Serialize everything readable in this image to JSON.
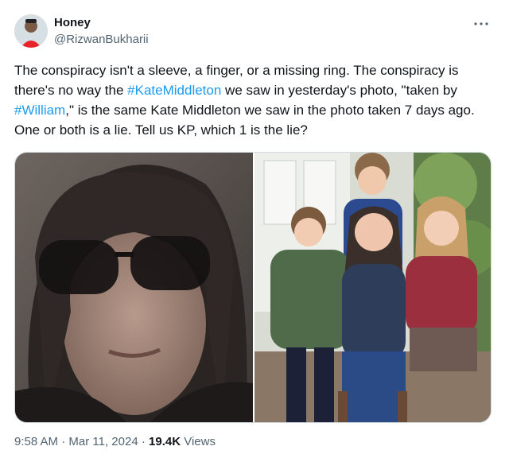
{
  "author": {
    "display_name": "Honey",
    "handle": "@RizwanBukharii"
  },
  "tweet": {
    "text_1": "The conspiracy isn't a sleeve, a finger, or a missing ring. The conspiracy is there's no way the ",
    "hashtag_1": "#KateMiddleton",
    "text_2": " we saw in yesterday's photo, \"taken by ",
    "hashtag_2": "#William",
    "text_3": ",\" is the same Kate Middleton we saw in the photo taken 7 days ago. One or both is a lie. Tell us KP, which 1 is the lie?"
  },
  "meta": {
    "time": "9:58 AM",
    "sep": " · ",
    "date": "Mar 11, 2024",
    "sep2": " · ",
    "views_count": "19.4K",
    "views_label": " Views"
  },
  "icons": {
    "more": "more-horizontal-icon",
    "avatar": "avatar-image"
  },
  "colors": {
    "link": "#1d9bf0",
    "muted": "#536471",
    "text": "#0f1419",
    "border": "#cfd9de"
  }
}
